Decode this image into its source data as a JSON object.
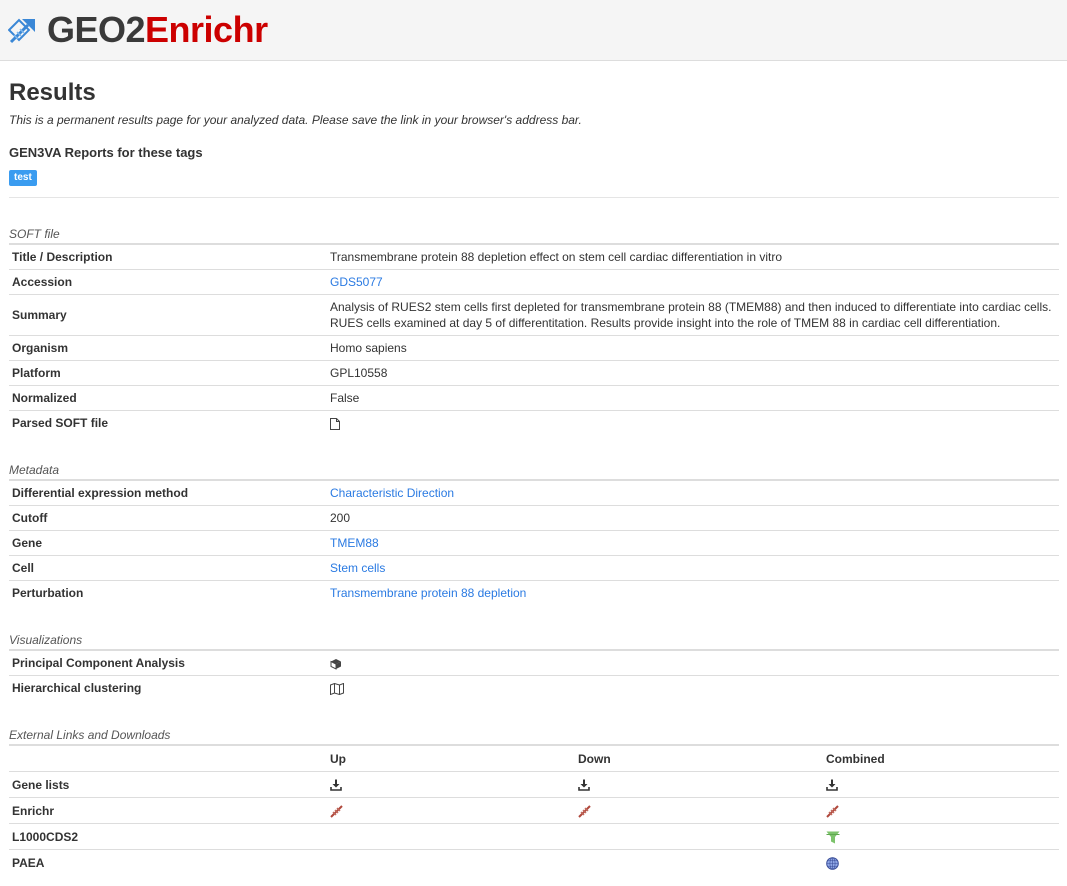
{
  "header": {
    "brand_part1": "GEO2",
    "brand_part2": "Enrichr",
    "logo_icon": "molecule-arrows-icon"
  },
  "page": {
    "title": "Results",
    "subtitle": "This is a permanent results page for your analyzed data. Please save the link in your browser's address bar.",
    "tags_heading": "GEN3VA Reports for these tags",
    "tags": [
      "test"
    ]
  },
  "soft_file": {
    "section_title": "SOFT file",
    "rows": [
      {
        "label": "Title / Description",
        "value": "Transmembrane protein 88 depletion effect on stem cell cardiac differentiation in vitro"
      },
      {
        "label": "Accession",
        "value": "GDS5077"
      },
      {
        "label": "Summary",
        "value": "Analysis of RUES2 stem cells first depleted for transmembrane protein 88 (TMEM88) and then induced to differentiate into cardiac cells. RUES cells examined at day 5 of differentitation. Results provide insight into the role of TMEM 88 in cardiac cell differentiation."
      },
      {
        "label": "Organism",
        "value": "Homo sapiens"
      },
      {
        "label": "Platform",
        "value": "GPL10558"
      },
      {
        "label": "Normalized",
        "value": "False"
      },
      {
        "label": "Parsed SOFT file",
        "icon": "file-icon"
      }
    ]
  },
  "metadata": {
    "section_title": "Metadata",
    "rows": [
      {
        "label": "Differential expression method",
        "value": "Characteristic Direction"
      },
      {
        "label": "Cutoff",
        "value": "200"
      },
      {
        "label": "Gene",
        "value": "TMEM88"
      },
      {
        "label": "Cell",
        "value": "Stem cells"
      },
      {
        "label": "Perturbation",
        "value": "Transmembrane protein 88 depletion"
      }
    ]
  },
  "visualizations": {
    "section_title": "Visualizations",
    "rows": [
      {
        "label": "Principal Component Analysis",
        "icon": "cube-icon"
      },
      {
        "label": "Hierarchical clustering",
        "icon": "map-icon"
      }
    ]
  },
  "external": {
    "section_title": "External Links and Downloads",
    "columns": [
      "Up",
      "Down",
      "Combined"
    ],
    "rows": [
      {
        "label": "Gene lists",
        "icon": "download-icon"
      },
      {
        "label": "Enrichr",
        "icon": "enrichr-icon"
      },
      {
        "label": "L1000CDS2",
        "icon": "funnel-icon"
      },
      {
        "label": "PAEA",
        "icon": "globe-icon"
      }
    ]
  },
  "colors": {
    "link": "#2a7ae2",
    "brand_red": "#cc0000",
    "tag_blue": "#3a9cf0"
  }
}
